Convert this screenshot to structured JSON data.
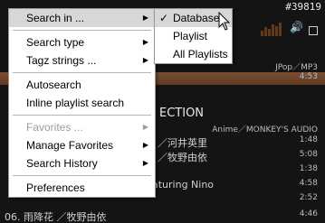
{
  "player": {
    "counter": "#39819",
    "format_top": "JPop／MP3",
    "time_top": "4:53",
    "album_title_fragment": "ECTION",
    "album_format": "Anime／MONKEY'S AUDIO",
    "tracks": [
      {
        "title": "／河井英里",
        "duration": "1:48"
      },
      {
        "title": "／牧野由依",
        "duration": "5:08"
      },
      {
        "title": "",
        "duration": "1:38"
      },
      {
        "title": "aturing Nino",
        "duration": "4:58"
      },
      {
        "title": "",
        "duration": "2:52"
      },
      {
        "title": "06. 雨降花 ／牧野由依",
        "duration": "4:46"
      }
    ]
  },
  "menu": {
    "search_in": "Search in ...",
    "search_type": "Search type",
    "tagz_strings": "Tagz strings ...",
    "autosearch": "Autosearch",
    "inline_playlist_search": "Inline playlist search",
    "favorites": "Favorites ...",
    "manage_favorites": "Manage Favorites",
    "search_history": "Search History",
    "preferences": "Preferences"
  },
  "submenu": {
    "database": "Database",
    "playlist": "Playlist",
    "all_playlists": "All Playlists",
    "check_glyph": "✓"
  },
  "icons": {
    "submenu_arrow": "▶",
    "volume": "🔊"
  },
  "colors": {
    "highlight": "#d7d7d7",
    "disabled": "#9a9a9a",
    "player_bg": "#141414",
    "track_highlight": "#6b4329"
  }
}
